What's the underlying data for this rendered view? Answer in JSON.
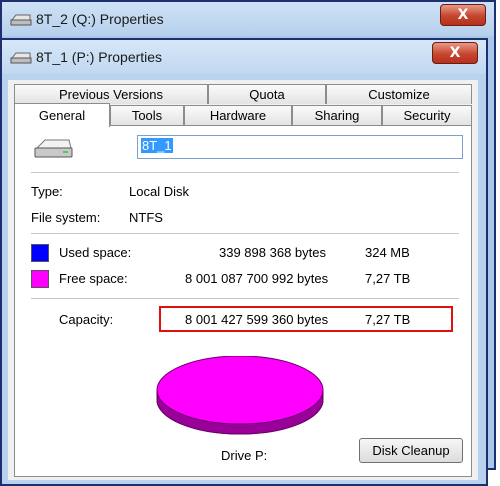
{
  "back_window": {
    "title": "8T_2 (Q:) Properties",
    "close_label": "X"
  },
  "front_window": {
    "title": "8T_1 (P:) Properties",
    "close_label": "X"
  },
  "tabs_top": [
    "Previous Versions",
    "Quota",
    "Customize"
  ],
  "tabs_bottom": [
    "General",
    "Tools",
    "Hardware",
    "Sharing",
    "Security"
  ],
  "general": {
    "name_value": "8T_1",
    "type_label": "Type:",
    "type_value": "Local Disk",
    "fs_label": "File system:",
    "fs_value": "NTFS",
    "used_label": "Used space:",
    "used_bytes": "339 898 368 bytes",
    "used_size": "324 MB",
    "free_label": "Free space:",
    "free_bytes": "8 001 087 700 992 bytes",
    "free_size": "7,27 TB",
    "capacity_label": "Capacity:",
    "capacity_bytes": "8 001 427 599 360 bytes",
    "capacity_size": "7,27 TB",
    "drive_label": "Drive P:",
    "cleanup_button": "Disk Cleanup"
  },
  "colors": {
    "used": "#0000ff",
    "free": "#ff00ff"
  }
}
